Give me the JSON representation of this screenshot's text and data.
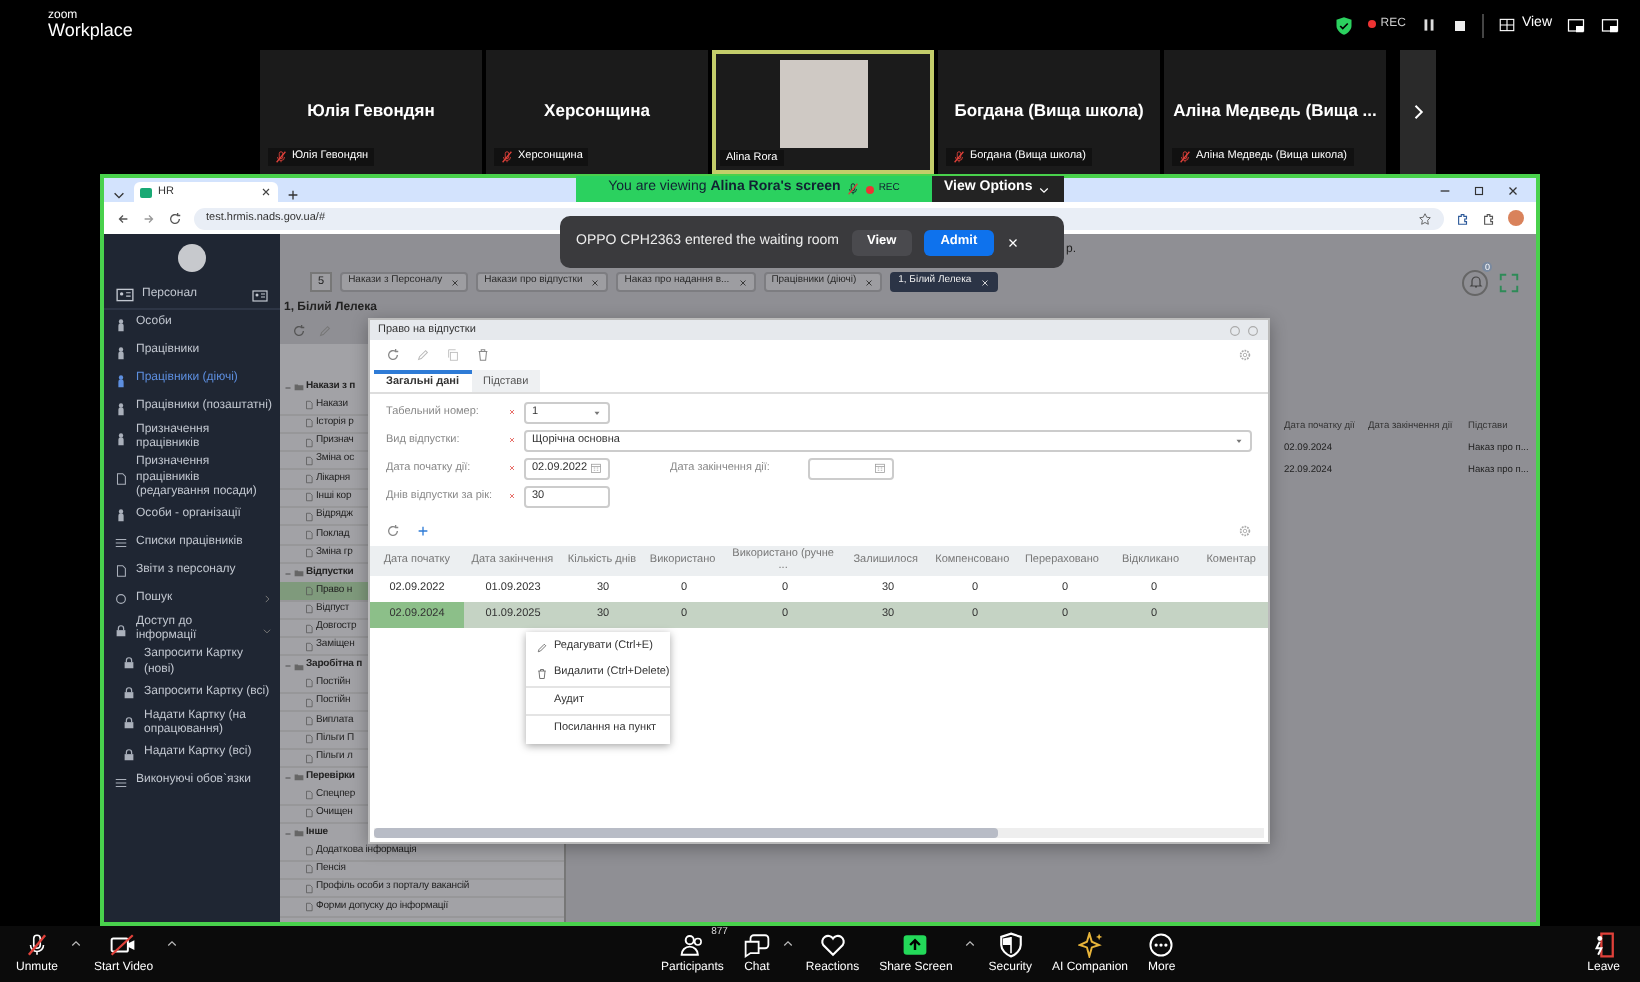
{
  "zoom_header": {
    "logo_top": "zoom",
    "logo_bottom": "Workplace",
    "secure": true,
    "recording": true,
    "rec_label": "REC",
    "view_label": "View"
  },
  "participants": [
    {
      "name": "Юлія Гевондян",
      "label": "Юлія Гевондян",
      "muted": true,
      "video": false,
      "selected": false
    },
    {
      "name": "Херсонщина",
      "label": "Херсонщина",
      "muted": true,
      "video": false,
      "selected": false
    },
    {
      "label": "Alina Rora",
      "muted": false,
      "video": true,
      "selected": true
    },
    {
      "name": "Богдана (Вища школа)",
      "label": "Богдана (Вища школа)",
      "muted": true,
      "video": false,
      "selected": false
    },
    {
      "name": "Аліна Медведь (Вища ...",
      "label": "Аліна Медведь (Вища школа)",
      "muted": true,
      "video": false,
      "selected": false
    }
  ],
  "share_banner": {
    "text": "You are viewing",
    "sharer": "Alina Rora's screen",
    "rec_label": "REC",
    "options": "View Options"
  },
  "browser": {
    "tab_title": "HR",
    "url": "test.hrmis.nads.gov.ua/#"
  },
  "toast": {
    "message": "OPPO CPH2363 entered the waiting room",
    "view": "View",
    "admit": "Admit"
  },
  "app": {
    "header_fragment": "р.",
    "sidebar": {
      "title": "Персонал",
      "items": [
        {
          "label": "Особи",
          "kind": "person",
          "selected": false
        },
        {
          "label": "Працівники",
          "kind": "person",
          "selected": false
        },
        {
          "label": "Працівники (діючі)",
          "kind": "person",
          "selected": true
        },
        {
          "label": "Працівники (позаштатні)",
          "kind": "person",
          "selected": false
        },
        {
          "label": "Призначення працівників",
          "kind": "person",
          "selected": false
        },
        {
          "label": "Призначення працівників (редагування посади)",
          "kind": "doc",
          "selected": false
        },
        {
          "label": "Особи - організації",
          "kind": "person",
          "selected": false
        },
        {
          "label": "Списки працівників",
          "kind": "list",
          "selected": false
        },
        {
          "label": "Звіти з персоналу",
          "kind": "doc",
          "selected": false
        },
        {
          "label": "Пошук",
          "kind": "circle",
          "selected": false,
          "expanded": false
        },
        {
          "label": "Доступ до інформації",
          "kind": "lock",
          "selected": false,
          "expanded": true,
          "children": [
            {
              "label": "Запросити Картку (нові)",
              "kind": "lock",
              "selected": false
            },
            {
              "label": "Запросити Картку (всі)",
              "kind": "lock",
              "selected": false
            },
            {
              "label": "Надати Картку (на опрацювання)",
              "kind": "lock",
              "selected": false
            },
            {
              "label": "Надати Картку (всі)",
              "kind": "lock",
              "selected": false
            }
          ]
        },
        {
          "label": "Виконуючі обов`язки",
          "kind": "list",
          "selected": false
        }
      ]
    },
    "tab_count": "5",
    "tabs": [
      {
        "label": "Накази з Персоналу",
        "selected": false
      },
      {
        "label": "Накази про відпустки",
        "selected": false
      },
      {
        "label": "Наказ про надання в...",
        "selected": false
      },
      {
        "label": "Працівники (діючі)",
        "selected": false
      },
      {
        "label": "1, Білий Лелека",
        "selected": true
      }
    ],
    "notifications": "0",
    "heading": "1, Білий Лелека",
    "tree": [
      {
        "label": "Накази з п",
        "children": [
          {
            "label": "Накази",
            "selected": false
          },
          {
            "label": "Історія р",
            "selected": false
          },
          {
            "label": "Признач",
            "selected": false
          },
          {
            "label": "Зміна ос",
            "selected": false
          },
          {
            "label": "Лікарня",
            "selected": false
          },
          {
            "label": "Інші кор",
            "selected": false
          },
          {
            "label": "Відрядж",
            "selected": false
          },
          {
            "label": "Поклад",
            "selected": false
          },
          {
            "label": "Зміна гр",
            "selected": false
          }
        ]
      },
      {
        "label": "Відпустки",
        "children": [
          {
            "label": "Право н",
            "selected": true
          },
          {
            "label": "Відпуст",
            "selected": false
          },
          {
            "label": "Довгостр",
            "selected": false
          },
          {
            "label": "Заміщен",
            "selected": false
          }
        ]
      },
      {
        "label": "Заробітна п",
        "children": [
          {
            "label": "Постійн",
            "selected": false
          },
          {
            "label": "Постійн",
            "selected": false
          },
          {
            "label": "Виплата",
            "selected": false
          },
          {
            "label": "Пільги П",
            "selected": false
          },
          {
            "label": "Пільги л",
            "selected": false
          }
        ]
      },
      {
        "label": "Перевірки",
        "children": [
          {
            "label": "Спецпер",
            "selected": false
          },
          {
            "label": "Очищен",
            "selected": false
          }
        ]
      },
      {
        "label": "Інше",
        "children": [
          {
            "label": "Додаткова інформація",
            "selected": false
          },
          {
            "label": "Пенсія",
            "selected": false
          },
          {
            "label": "Профіль особи з порталу вакансій",
            "selected": false
          },
          {
            "label": "Форми допуску до інформації",
            "selected": false
          }
        ]
      }
    ],
    "grid": {
      "columns": [
        "Дата початку дії",
        "Дата закінчення дії",
        "Підстави"
      ],
      "rows": [
        {
          "start": "02.09.2024",
          "basis": "Наказ про п..."
        },
        {
          "start": "22.09.2024",
          "basis": "Наказ про п..."
        }
      ]
    }
  },
  "dialog": {
    "title": "Право на відпустки",
    "tabs": [
      {
        "label": "Загальні дані",
        "selected": true
      },
      {
        "label": "Підстави",
        "selected": false
      }
    ],
    "form_rows": [
      [
        {
          "label": "Табельний номер:",
          "required": true,
          "value": "1",
          "kind": "select"
        }
      ],
      [
        {
          "label": "Вид відпустки:",
          "required": true,
          "value": "Щорічна основна",
          "kind": "select-wide"
        }
      ],
      [
        {
          "label": "Дата початку дії:",
          "required": true,
          "value": "02.09.2022",
          "kind": "date"
        },
        {
          "label": "Дата закінчення дії:",
          "required": false,
          "kind": "date"
        }
      ],
      [
        {
          "label": "Днів відпустки за рік:",
          "required": true,
          "value": "30",
          "kind": "text"
        }
      ]
    ],
    "columns": [
      "Дата початку",
      "Дата закінчення",
      "Кількість днів",
      "Використано",
      "Використано (ручне ...",
      "Залишилося",
      "Компенсовано",
      "Перераховано",
      "Відкликано",
      "Коментар"
    ],
    "rows": [
      {
        "cells": [
          "02.09.2022",
          "01.09.2023",
          "30",
          "0",
          "0",
          "30",
          "0",
          "0",
          "0"
        ],
        "selected": false
      },
      {
        "cells": [
          "02.09.2024",
          "01.09.2025",
          "30",
          "0",
          "0",
          "30",
          "0",
          "0",
          "0"
        ],
        "selected": true
      }
    ]
  },
  "context_menu": [
    {
      "label": "Редагувати (Ctrl+E)",
      "kind": "pencil"
    },
    {
      "label": "Видалити (Ctrl+Delete)",
      "kind": "trash"
    },
    {
      "label": "Аудит",
      "kind": "plain"
    },
    {
      "label": "Посилання на пункт",
      "kind": "plain"
    }
  ],
  "toolbar": [
    {
      "kind": "mic",
      "label": "Unmute",
      "caret": true
    },
    {
      "kind": "video",
      "label": "Start Video",
      "caret": true
    },
    {
      "kind": "participants",
      "label": "Participants",
      "count": "877",
      "caret": false
    },
    {
      "kind": "chat",
      "label": "Chat",
      "caret": true
    },
    {
      "kind": "reactions",
      "label": "Reactions",
      "caret": false
    },
    {
      "kind": "share",
      "label": "Share Screen",
      "caret": true
    },
    {
      "kind": "security",
      "label": "Security",
      "caret": false
    },
    {
      "kind": "ai",
      "label": "AI Companion",
      "caret": false
    },
    {
      "kind": "more",
      "label": "More",
      "caret": false
    },
    {
      "kind": "leave",
      "label": "Leave",
      "caret": false
    }
  ]
}
